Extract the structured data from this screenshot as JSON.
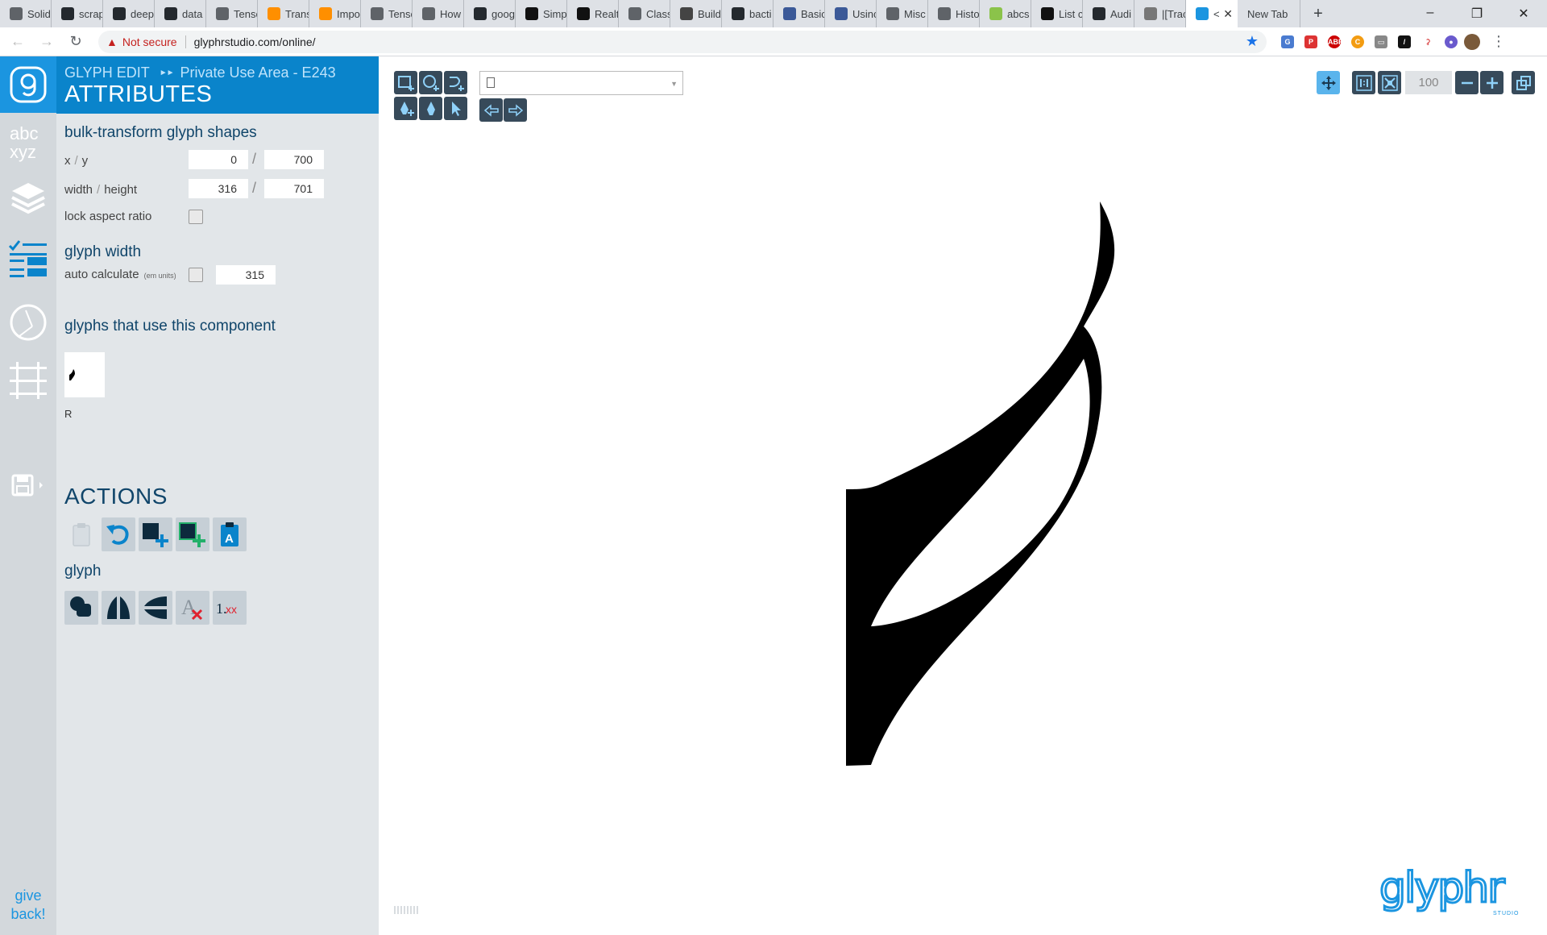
{
  "browser": {
    "tabs": [
      {
        "label": "Solid",
        "icon": "doc-icon",
        "color": "#5f6368"
      },
      {
        "label": "scrap",
        "icon": "github-icon",
        "color": "#24292e"
      },
      {
        "label": "deep",
        "icon": "github-icon",
        "color": "#24292e"
      },
      {
        "label": "data",
        "icon": "github-icon",
        "color": "#24292e"
      },
      {
        "label": "Tenso",
        "icon": "globe-icon",
        "color": "#5f6368"
      },
      {
        "label": "Trans",
        "icon": "tensorflow-icon",
        "color": "#ff8f00"
      },
      {
        "label": "Impo",
        "icon": "tensorflow-icon",
        "color": "#ff8f00"
      },
      {
        "label": "Tenso",
        "icon": "code-icon",
        "color": "#5f6368"
      },
      {
        "label": "How",
        "icon": "globe-icon",
        "color": "#5f6368"
      },
      {
        "label": "goog",
        "icon": "github-icon",
        "color": "#24292e"
      },
      {
        "label": "Simp",
        "icon": "medium-icon",
        "color": "#111"
      },
      {
        "label": "Realt",
        "icon": "medium-icon",
        "color": "#111"
      },
      {
        "label": "Class",
        "icon": "globe-icon",
        "color": "#5f6368"
      },
      {
        "label": "Build",
        "icon": "barcode-icon",
        "color": "#444"
      },
      {
        "label": "bacti",
        "icon": "github-icon",
        "color": "#24292e"
      },
      {
        "label": "Basic",
        "icon": "c-icon",
        "color": "#3b5998"
      },
      {
        "label": "Usinc",
        "icon": "c-icon",
        "color": "#3b5998"
      },
      {
        "label": "Misc",
        "icon": "globe-icon",
        "color": "#5f6368"
      },
      {
        "label": "Histo",
        "icon": "doc-icon",
        "color": "#5f6368"
      },
      {
        "label": "abcs",
        "icon": "pencil-icon",
        "color": "#8bc34a"
      },
      {
        "label": "List c",
        "icon": "wikipedia-icon",
        "color": "#111"
      },
      {
        "label": "Audi",
        "icon": "github-icon",
        "color": "#24292e"
      },
      {
        "label": "|[Trac",
        "icon": "arrow-icon",
        "color": "#777"
      }
    ],
    "active_tab": {
      "label": "<",
      "icon": "glyphr-icon",
      "color": "#1b95e0"
    },
    "new_tab": {
      "label": "New Tab"
    },
    "not_secure": "Not secure",
    "url": "glyphrstudio.com/online/"
  },
  "nav": {
    "give_back": [
      "give",
      "back!"
    ]
  },
  "panel": {
    "breadcrumb_app": "GLYPH EDIT",
    "breadcrumb_glyph": "Private Use Area - E243",
    "title": "ATTRIBUTES",
    "bulk_title": "bulk-transform glyph shapes",
    "xy_label_x": "x",
    "xy_label_y": "y",
    "x_value": "0",
    "y_value": "700",
    "wh_label_w": "width",
    "wh_label_h": "height",
    "width_value": "316",
    "height_value": "701",
    "lock_aspect_label": "lock aspect ratio",
    "glyph_width_title": "glyph width",
    "auto_calc_label": "auto calculate",
    "em_units": "(em units)",
    "glyph_width_value": "315",
    "uses_title": "glyphs that use this component",
    "uses_glyph_label": "R",
    "actions_title": "ACTIONS",
    "glyph_section_title": "glyph"
  },
  "canvas": {
    "zoom": "100"
  },
  "colors": {
    "brand_blue": "#1b95e0",
    "header_blue": "#0a84cb",
    "dark_button": "#374a5a",
    "panel_bg": "#e2e6e9",
    "rail_bg": "#d3d8dc"
  }
}
